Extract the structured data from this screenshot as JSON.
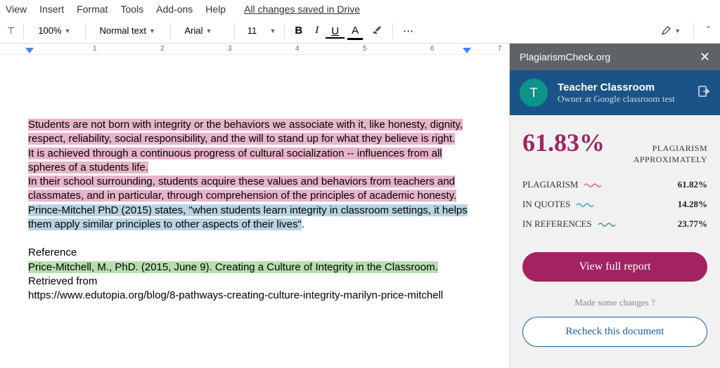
{
  "menu": {
    "view": "View",
    "insert": "Insert",
    "format": "Format",
    "tools": "Tools",
    "addons": "Add-ons",
    "help": "Help",
    "saved": "All changes saved in Drive"
  },
  "toolbar": {
    "zoom": "100%",
    "style": "Normal text",
    "font": "Arial",
    "size": "11",
    "bold": "B",
    "italic": "I",
    "underline": "U",
    "color": "A",
    "more": "⋯"
  },
  "ruler": {
    "marks": [
      "1",
      "2",
      "3",
      "4",
      "5",
      "6",
      "7"
    ]
  },
  "doc": {
    "p1": "Students are not born with integrity or the behaviors we associate with it, like honesty, dignity, respect, reliability, social responsibility, and the will to stand up for what they believe is right.",
    "p2": "It is achieved through a continuous progress of cultural socialization -- influences from all spheres of a students life.",
    "p3": "In their school surrounding, students acquire these values and behaviors from teachers and classmates, and in particular, through comprehension of the principles of academic honesty.",
    "p4a": "Prince-Mitchel PhD (2015) states, \"when students learn integrity in classroom settings, it helps them apply similar principles to other aspects of their lives\"",
    "p4b": ".",
    "ref_h": "Reference",
    "ref1": "Price-Mitchell, M., PhD. (2015, June 9). Creating a Culture of Integrity in the Classroom.",
    "ref2": "Retrieved from",
    "ref3": "https://www.edutopia.org/blog/8-pathways-creating-culture-integrity-marilyn-price-mitchell"
  },
  "panel": {
    "title": "PlagiarismCheck.org",
    "user": {
      "initial": "T",
      "name": "Teacher Classroom",
      "role": "Owner at Google classroom test"
    },
    "score": {
      "pct": "61.83%",
      "label1": "PLAGIARISM",
      "label2": "APPROXIMATELY"
    },
    "stats": {
      "plagiarism": {
        "label": "PLAGIARISM",
        "val": "61.82%"
      },
      "quotes": {
        "label": "IN QUOTES",
        "val": "14.28%"
      },
      "refs": {
        "label": "IN REFERENCES",
        "val": "23.77%"
      }
    },
    "full_report": "View full report",
    "changes_q": "Made some changes ?",
    "recheck": "Recheck this document"
  }
}
